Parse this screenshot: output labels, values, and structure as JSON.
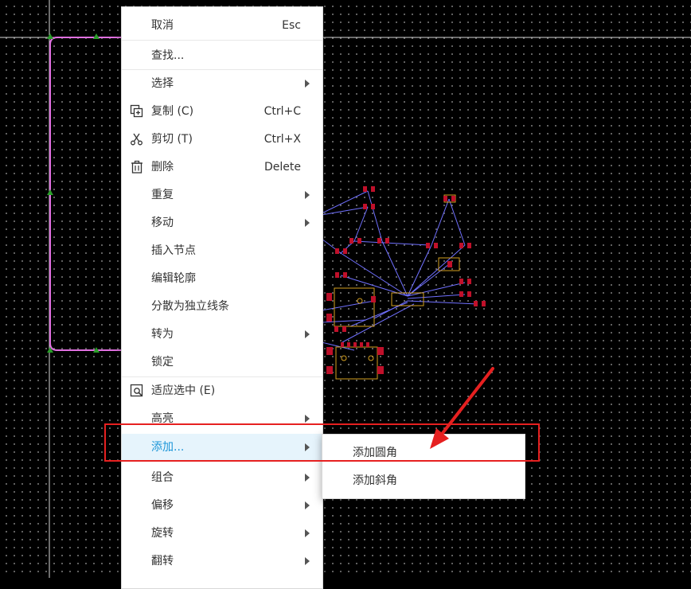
{
  "context_menu": {
    "items": [
      {
        "label": "取消",
        "shortcut": "Esc"
      },
      {
        "label": "查找..."
      },
      {
        "label": "选择"
      },
      {
        "label": "复制 (C)",
        "shortcut": "Ctrl+C",
        "icon": "copy-icon"
      },
      {
        "label": "剪切 (T)",
        "shortcut": "Ctrl+X",
        "icon": "scissors-icon"
      },
      {
        "label": "删除",
        "shortcut": "Delete",
        "icon": "trash-icon"
      },
      {
        "label": "重复"
      },
      {
        "label": "移动"
      },
      {
        "label": "插入节点"
      },
      {
        "label": "编辑轮廓"
      },
      {
        "label": "分散为独立线条"
      },
      {
        "label": "转为"
      },
      {
        "label": "锁定"
      },
      {
        "label": "适应选中 (E)",
        "icon": "zoom-fit-icon"
      },
      {
        "label": "高亮"
      },
      {
        "label": "添加..."
      },
      {
        "label": "组合"
      },
      {
        "label": "偏移"
      },
      {
        "label": "旋转"
      },
      {
        "label": "翻转"
      }
    ],
    "highlighted_color": "#1d96d8",
    "highlighted_bg": "#e6f4fc"
  },
  "submenu": {
    "items": [
      {
        "label": "添加圆角"
      },
      {
        "label": "添加斜角"
      }
    ]
  },
  "annotation": {
    "color": "#e62020"
  },
  "canvas": {
    "background": "#000000",
    "outline_color": "#e070e0",
    "ratline_color": "#7070ff",
    "pad_color": "#c0102a",
    "silk_color": "#d4a020"
  }
}
